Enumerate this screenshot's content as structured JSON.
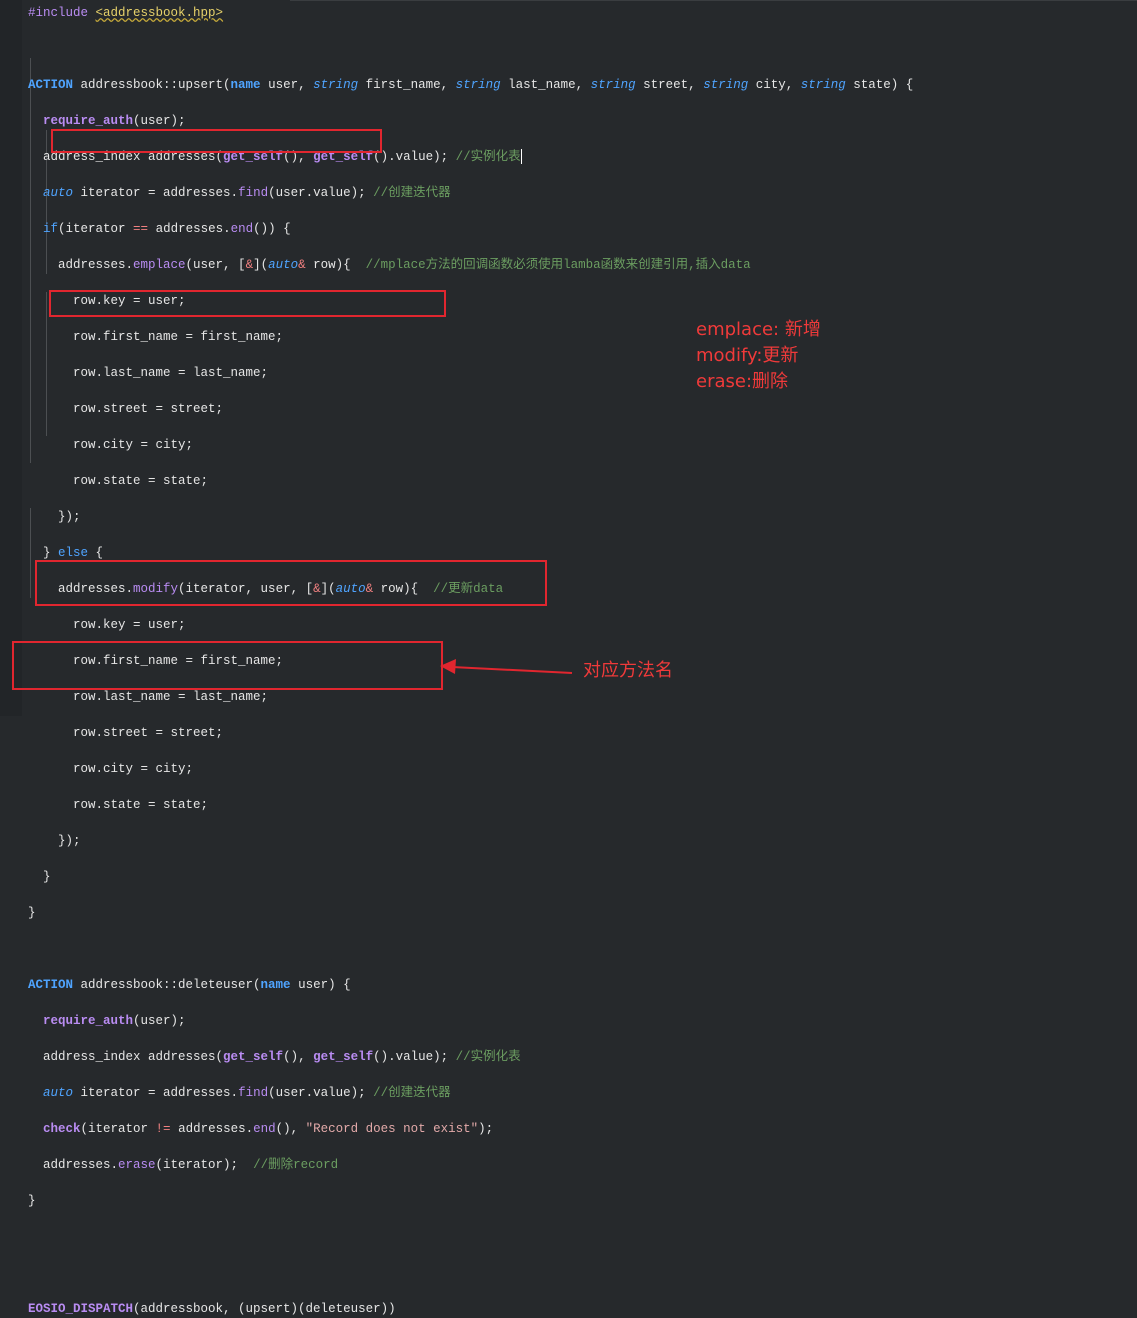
{
  "code_lines": {
    "l1_include": "#include",
    "l1_header": "<addressbook.hpp>",
    "l3_action": "ACTION",
    "l3_sig_a": " addressbook::upsert(",
    "l3_name": "name",
    "l3_sig_b": " user, ",
    "l3_string1": "string",
    "l3_sig_c": " first_name, ",
    "l3_string2": "string",
    "l3_sig_d": " last_name, ",
    "l3_string3": "string",
    "l3_sig_e": " street, ",
    "l3_string4": "string",
    "l3_sig_f": " city, ",
    "l3_string5": "string",
    "l3_sig_g": " state) {",
    "l4_fn": "require_auth",
    "l4_rest": "(user);",
    "l5_a": "address_index addresses(",
    "l5_fn1": "get_self",
    "l5_b": "(), ",
    "l5_fn2": "get_self",
    "l5_c": "().value); ",
    "l5_cm": "//实例化表",
    "l6_auto": "auto",
    "l6_a": " iterator = addresses.",
    "l6_fn": "find",
    "l6_b": "(user.value); ",
    "l6_cm": "//创建迭代器",
    "l7_if": "if",
    "l7_a": "(iterator ",
    "l7_op": "==",
    "l7_b": " addresses.",
    "l7_fn": "end",
    "l7_c": "()) {",
    "l8_a": "addresses.",
    "l8_fn": "emplace",
    "l8_b": "(user, [",
    "l8_op": "&",
    "l8_c": "](",
    "l8_auto": "auto",
    "l8_op2": "&",
    "l8_d": " row){",
    "l8_gap": "  ",
    "l8_cm": "//mplace方法的回调函数必须使用lamba函数来创建引用,插入data",
    "l9": "row.key = user;",
    "l10": "row.first_name = first_name;",
    "l11": "row.last_name = last_name;",
    "l12": "row.street = street;",
    "l13": "row.city = city;",
    "l14": "row.state = state;",
    "l15": "});",
    "l16_a": "} ",
    "l16_else": "else",
    "l16_b": " {",
    "l17_a": "addresses.",
    "l17_fn": "modify",
    "l17_b": "(iterator, user, [",
    "l17_op": "&",
    "l17_c": "](",
    "l17_auto": "auto",
    "l17_op2": "&",
    "l17_d": " row){",
    "l17_gap": "  ",
    "l17_cm": "//更新data",
    "l18": "row.key = user;",
    "l19": "row.first_name = first_name;",
    "l20": "row.last_name = last_name;",
    "l21": "row.street = street;",
    "l22": "row.city = city;",
    "l23": "row.state = state;",
    "l24": "});",
    "l25": "}",
    "l26": "}",
    "l28_action": "ACTION",
    "l28_a": " addressbook::deleteuser(",
    "l28_name": "name",
    "l28_b": " user) {",
    "l29_fn": "require_auth",
    "l29_rest": "(user);",
    "l30_a": "address_index addresses(",
    "l30_fn1": "get_self",
    "l30_b": "(), ",
    "l30_fn2": "get_self",
    "l30_c": "().value); ",
    "l30_cm": "//实例化表",
    "l31_auto": "auto",
    "l31_a": " iterator = addresses.",
    "l31_fn": "find",
    "l31_b": "(user.value); ",
    "l31_cm": "//创建迭代器",
    "l32_fn": "check",
    "l32_a": "(iterator ",
    "l32_op": "!=",
    "l32_b": " addresses.",
    "l32_fn2": "end",
    "l32_c": "(), ",
    "l32_str": "\"Record does not exist\"",
    "l32_d": ");",
    "l33_a": "addresses.",
    "l33_fn": "erase",
    "l33_b": "(iterator);  ",
    "l33_cm": "//删除record",
    "l34": "}",
    "l37_macro": "EOSIO_DISPATCH",
    "l37_rest": "(addressbook, (upsert)(deleteuser))"
  },
  "annotations": {
    "emplace": "emplace: 新增",
    "modify": "modify:更新",
    "erase": "erase:删除",
    "dispatch": "对应方法名"
  },
  "colors": {
    "background": "#26292c",
    "keyword": "#4fa4ff",
    "function": "#b98cf2",
    "comment": "#6b9d60",
    "annotation": "#e1262f"
  }
}
